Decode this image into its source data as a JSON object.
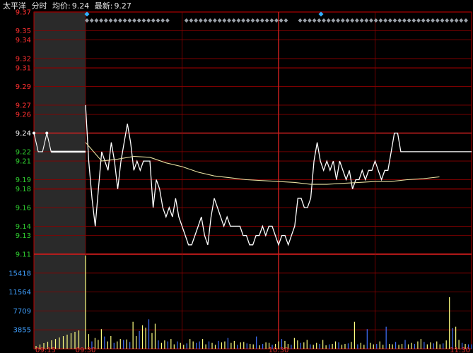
{
  "header": {
    "stock_name": "太平洋",
    "mode_label": "分时",
    "avg_label": "均价:",
    "avg_value": "9.24",
    "last_label": "最新:",
    "last_value": "9.27"
  },
  "colors": {
    "background": "#000000",
    "grid": "#8b0000",
    "axis_border": "#c00000",
    "price_line": "#ffffff",
    "avg_line": "#e8e0a0",
    "volume_up": "#ffff80",
    "volume_down": "#4070ff",
    "label_up": "#ff3030",
    "label_down": "#30d030",
    "prev_close_label": "#ffffff",
    "volume_label": "#40a0ff",
    "marker": "#9aa0a8",
    "marker_accent": "#30b0ff",
    "preopen_shade": "#2a2a2a"
  },
  "chart_data": {
    "type": "line",
    "title": "太平洋 分时",
    "prev_close": 9.24,
    "price_axis": {
      "ticks": [
        "9.37",
        "9.35",
        "9.34",
        "9.32",
        "9.31",
        "9.29",
        "9.27",
        "9.26",
        "9.24",
        "9.22",
        "9.21",
        "9.19",
        "9.18",
        "9.16",
        "9.14",
        "9.13",
        "9.11"
      ],
      "ylim": [
        9.11,
        9.37
      ]
    },
    "volume_axis": {
      "ticks": [
        "15418",
        "11564",
        "7709",
        "3855"
      ],
      "ylim": [
        0,
        19272
      ]
    },
    "time_axis": {
      "labels": [
        "09:15",
        "09:30",
        "10:30",
        "11:30"
      ]
    },
    "series": [
      {
        "name": "price",
        "x": [
          0,
          1,
          2,
          3,
          4,
          5,
          6,
          7,
          8,
          9,
          10,
          11,
          12,
          13,
          14,
          15,
          16,
          17,
          18,
          19,
          20,
          21,
          22,
          23,
          24,
          25,
          26,
          27,
          28,
          29,
          30,
          31,
          32,
          33,
          34,
          35,
          36,
          37,
          38,
          39,
          40,
          41,
          42,
          43,
          44,
          45,
          46,
          47,
          48,
          49,
          50,
          51,
          52,
          53,
          54,
          55,
          56,
          57,
          58,
          59,
          60,
          61,
          62,
          63,
          64,
          65,
          66,
          67,
          68,
          69,
          70,
          71,
          72,
          73,
          74,
          75,
          76,
          77,
          78,
          79,
          80,
          81,
          82,
          83,
          84,
          85,
          86,
          87,
          88,
          89,
          90,
          91,
          92,
          93,
          94,
          95,
          96,
          97,
          98,
          99,
          100,
          101,
          102,
          103,
          104,
          105,
          106,
          107,
          108,
          109,
          110,
          111,
          112,
          113,
          114,
          115,
          116,
          117,
          118,
          119,
          120
        ],
        "values": [
          9.27,
          9.21,
          9.17,
          9.14,
          9.18,
          9.22,
          9.21,
          9.2,
          9.23,
          9.21,
          9.18,
          9.21,
          9.23,
          9.25,
          9.23,
          9.2,
          9.21,
          9.2,
          9.21,
          9.21,
          9.21,
          9.16,
          9.19,
          9.18,
          9.16,
          9.15,
          9.16,
          9.15,
          9.17,
          9.15,
          9.14,
          9.13,
          9.12,
          9.12,
          9.13,
          9.14,
          9.15,
          9.13,
          9.12,
          9.15,
          9.17,
          9.16,
          9.15,
          9.14,
          9.15,
          9.14,
          9.14,
          9.14,
          9.14,
          9.13,
          9.13,
          9.12,
          9.12,
          9.13,
          9.13,
          9.14,
          9.13,
          9.14,
          9.14,
          9.13,
          9.12,
          9.13,
          9.13,
          9.12,
          9.13,
          9.14,
          9.17,
          9.17,
          9.16,
          9.16,
          9.17,
          9.21,
          9.23,
          9.21,
          9.2,
          9.21,
          9.2,
          9.21,
          9.19,
          9.21,
          9.2,
          9.19,
          9.2,
          9.18,
          9.19,
          9.19,
          9.2,
          9.19,
          9.2,
          9.2,
          9.21,
          9.2,
          9.19,
          9.2,
          9.2,
          9.22,
          9.24,
          9.24,
          9.22,
          9.22,
          9.22,
          9.22,
          9.22,
          9.22,
          9.22,
          9.22,
          9.22,
          9.22,
          9.22,
          9.22,
          9.22,
          9.22,
          9.22,
          9.22,
          9.22,
          9.22,
          9.22,
          9.22,
          9.22,
          9.22,
          9.22
        ]
      },
      {
        "name": "avg",
        "x": [
          0,
          5,
          10,
          15,
          20,
          25,
          30,
          35,
          40,
          45,
          50,
          55,
          60,
          65,
          70,
          75,
          80,
          85,
          90,
          95,
          100,
          105,
          110
        ],
        "values": [
          9.23,
          9.21,
          9.212,
          9.215,
          9.214,
          9.208,
          9.204,
          9.198,
          9.194,
          9.192,
          9.19,
          9.189,
          9.188,
          9.187,
          9.185,
          9.185,
          9.186,
          9.187,
          9.188,
          9.188,
          9.19,
          9.191,
          9.193
        ]
      }
    ],
    "preopen": {
      "prices": [
        9.24,
        9.22,
        9.22,
        9.24,
        9.22,
        9.22,
        9.22,
        9.22,
        9.22,
        9.22,
        9.22,
        9.22,
        9.22
      ]
    },
    "volume": {
      "values": [
        19000,
        3000,
        1500,
        2200,
        1800,
        4000,
        2500,
        1500,
        2600,
        1200,
        1500,
        2000,
        1800,
        1900,
        1400,
        5500,
        2600,
        3600,
        4800,
        4300,
        6000,
        3200,
        5100,
        1700,
        1200,
        1700,
        1500,
        2000,
        900,
        1500,
        1200,
        800,
        1100,
        2000,
        1500,
        1200,
        1500,
        2000,
        900,
        1500,
        1200,
        800,
        1600,
        1300,
        1500,
        2200,
        1200,
        1600,
        800,
        1300,
        1400,
        1100,
        1000,
        900,
        2500,
        700,
        1000,
        1300,
        1200,
        800,
        1000,
        1500,
        2000,
        1600,
        1000,
        800,
        2200,
        1700,
        1200,
        1300,
        1800,
        900,
        800,
        1200,
        1000,
        1800,
        700,
        900,
        1000,
        1500,
        1300,
        800,
        1000,
        1100,
        1400,
        5500,
        900,
        1200,
        800,
        4000,
        1200,
        900,
        1000,
        1500,
        800,
        4500,
        1000,
        900,
        1400,
        800,
        1000,
        1800,
        900,
        1200,
        1000,
        1500,
        2000,
        1400,
        900,
        1300,
        1100,
        1500,
        900,
        1100,
        1700,
        10500,
        4200,
        4500,
        1800,
        1200,
        1000,
        900,
        900
      ],
      "up_flags": [
        1,
        1,
        0,
        1,
        1,
        1,
        0,
        1,
        1,
        0,
        1,
        1,
        0,
        1,
        0,
        1,
        1,
        0,
        1,
        1,
        0,
        1,
        1,
        0,
        1,
        1,
        0,
        1,
        1,
        0,
        1,
        1,
        0,
        1,
        1,
        0,
        0,
        1,
        1,
        0,
        1,
        1,
        0,
        1,
        1,
        0,
        1,
        1,
        0,
        1,
        1,
        0,
        1,
        1,
        0,
        1,
        0,
        1,
        1,
        0,
        1,
        1,
        0,
        1,
        1,
        0,
        1,
        1,
        0,
        1,
        1,
        0,
        1,
        1,
        0,
        1,
        1,
        0,
        1,
        1,
        0,
        1,
        1,
        0,
        1,
        1,
        0,
        1,
        1,
        0,
        1,
        1,
        0,
        1,
        1,
        0,
        1,
        1,
        0,
        1,
        1,
        0,
        1,
        1,
        0,
        1,
        1,
        0,
        1,
        1,
        0,
        1,
        1,
        0,
        1,
        1,
        0,
        1,
        1,
        0,
        1
      ]
    }
  }
}
